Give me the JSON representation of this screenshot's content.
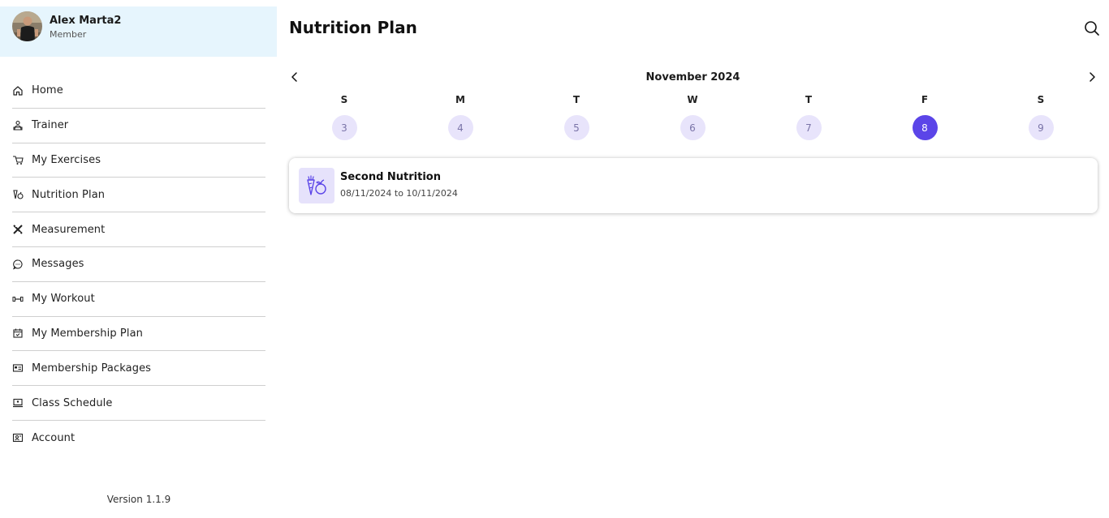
{
  "profile": {
    "name": "Alex Marta2",
    "role": "Member"
  },
  "sidebar": {
    "items": [
      {
        "label": "Home",
        "icon": "home-icon"
      },
      {
        "label": "Trainer",
        "icon": "trainer-icon"
      },
      {
        "label": "My Exercises",
        "icon": "exercises-icon"
      },
      {
        "label": "Nutrition Plan",
        "icon": "nutrition-icon"
      },
      {
        "label": "Measurement",
        "icon": "measurement-icon"
      },
      {
        "label": "Messages",
        "icon": "messages-icon"
      },
      {
        "label": "My Workout",
        "icon": "dumbbell-icon"
      },
      {
        "label": "My Membership Plan",
        "icon": "calendar-check-icon"
      },
      {
        "label": "Membership Packages",
        "icon": "card-icon"
      },
      {
        "label": "Class Schedule",
        "icon": "screen-icon"
      },
      {
        "label": "Account",
        "icon": "account-icon"
      }
    ],
    "version": "Version 1.1.9"
  },
  "header": {
    "title": "Nutrition Plan",
    "search_icon": "search-icon"
  },
  "calendar": {
    "month": "November 2024",
    "days": [
      {
        "letter": "S",
        "number": "3"
      },
      {
        "letter": "M",
        "number": "4"
      },
      {
        "letter": "T",
        "number": "5"
      },
      {
        "letter": "W",
        "number": "6"
      },
      {
        "letter": "T",
        "number": "7"
      },
      {
        "letter": "F",
        "number": "8"
      },
      {
        "letter": "S",
        "number": "9"
      }
    ],
    "selected_day": "8"
  },
  "plans": [
    {
      "name": "Second Nutrition",
      "dates": "08/11/2024 to 10/11/2024",
      "icon": "vegetables-icon"
    }
  ],
  "colors": {
    "accent": "#5b45e8",
    "day_bubble": "#e8e4fb",
    "profile_bg": "#e6f5fd"
  }
}
